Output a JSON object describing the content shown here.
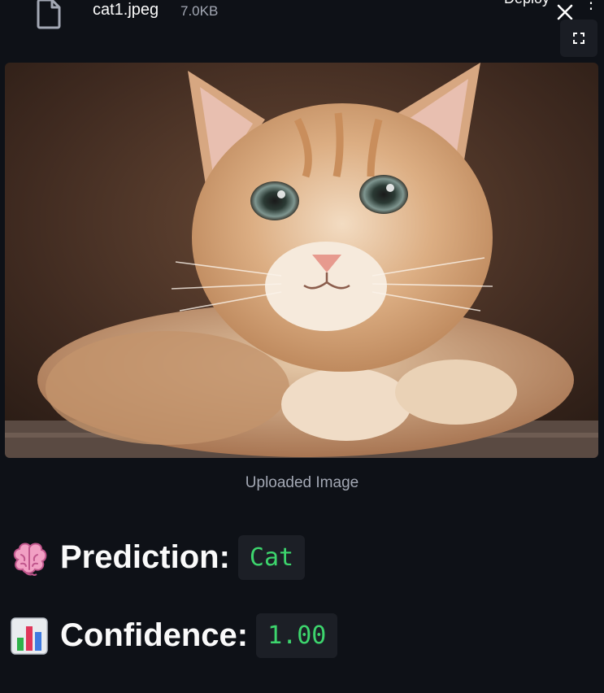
{
  "file": {
    "name": "cat1.jpeg",
    "size": "7.0KB"
  },
  "toolbar": {
    "deploy_label": "Deploy",
    "menu_glyph": "⋮"
  },
  "image": {
    "caption": "Uploaded Image",
    "subject": "orange tabby kitten"
  },
  "prediction": {
    "label": "Prediction:",
    "value": "Cat",
    "icon": "brain-icon"
  },
  "confidence": {
    "label": "Confidence:",
    "value": "1.00",
    "icon": "bar-chart-icon"
  },
  "colors": {
    "background": "#0e1117",
    "code_text": "#3dd56d",
    "code_background": "#1c1f26",
    "muted_text": "#a3a8b4"
  }
}
